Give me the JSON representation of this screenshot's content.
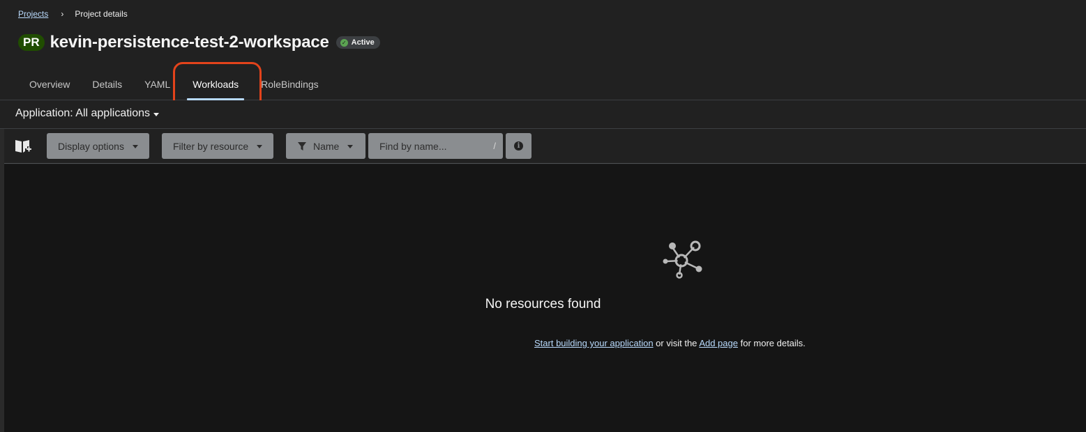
{
  "breadcrumb": {
    "parent": "Projects",
    "separator": "›",
    "current": "Project details"
  },
  "header": {
    "badge": "PR",
    "title": "kevin-persistence-test-2-workspace",
    "status": "Active"
  },
  "tabs": [
    {
      "label": "Overview"
    },
    {
      "label": "Details"
    },
    {
      "label": "YAML"
    },
    {
      "label": "Workloads",
      "active": true
    },
    {
      "label": "RoleBindings"
    }
  ],
  "application_selector": {
    "label": "Application: All applications"
  },
  "toolbar": {
    "guide_icon": "book-plus-icon",
    "display_options": "Display options",
    "filter_by_resource": "Filter by resource",
    "filter_type": "Name",
    "search_placeholder": "Find by name...",
    "search_shortcut": "/",
    "info_icon": "info-circle-icon"
  },
  "empty_state": {
    "icon": "topology-icon",
    "title": "No resources found",
    "link1": "Start building your application",
    "middle_text": " or visit the ",
    "link2": "Add page",
    "end_text": " for more details."
  },
  "colors": {
    "background": "#1b1b1b",
    "panel": "#212121",
    "link": "#b9dafc",
    "highlight": "#e3431b",
    "badge_green": "#204d00",
    "status_ok": "#5ba352"
  }
}
